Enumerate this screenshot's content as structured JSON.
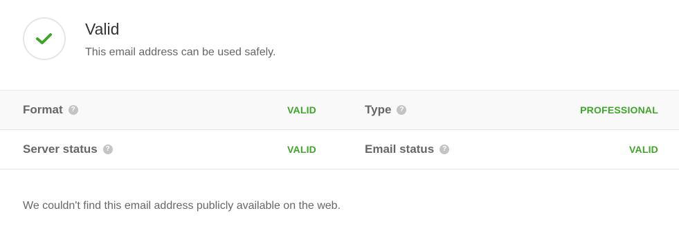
{
  "status": {
    "title": "Valid",
    "subtitle": "This email address can be used safely.",
    "icon": "check-icon",
    "color": "#3fa52a"
  },
  "results": {
    "rows": [
      {
        "left": {
          "label": "Format",
          "value": "VALID"
        },
        "right": {
          "label": "Type",
          "value": "PROFESSIONAL"
        }
      },
      {
        "left": {
          "label": "Server status",
          "value": "VALID"
        },
        "right": {
          "label": "Email status",
          "value": "VALID"
        }
      }
    ],
    "help_glyph": "?"
  },
  "footer": {
    "note": "We couldn't find this email address publicly available on the web."
  }
}
